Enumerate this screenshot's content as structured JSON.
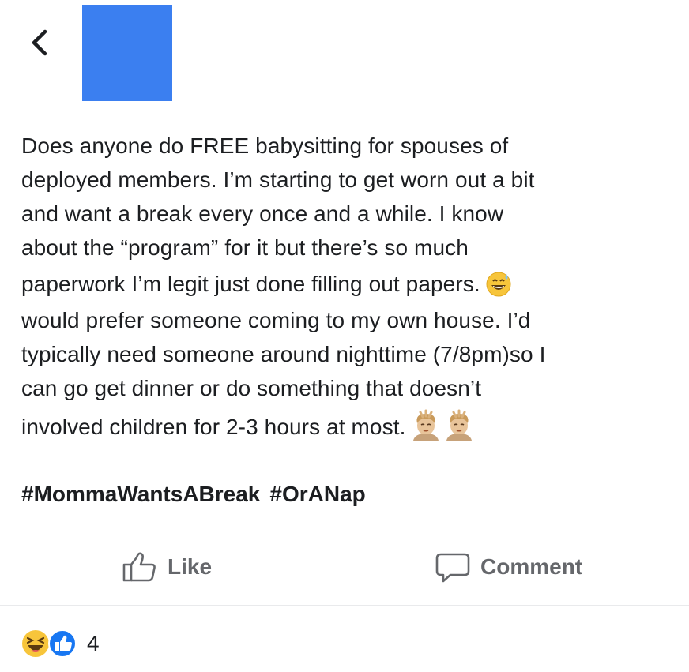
{
  "header": {
    "back_icon": "chevron-left-icon"
  },
  "post": {
    "lines": [
      "Does anyone do FREE babysitting for spouses of",
      "deployed members. I’m starting to get worn out a bit",
      "and want a break every once and a while. I know",
      "about the “program” for it but there’s so much",
      "paperwork I’m legit just done filling out papers.",
      "would prefer someone coming to my own house. I’d",
      "typically need someone around nighttime (7/8pm)so I",
      "can go get dinner or do something that doesn’t",
      "involved children for 2-3 hours at most."
    ],
    "hashtags": [
      "#MommaWantsABreak",
      "#OrANap"
    ]
  },
  "actions": {
    "like_label": "Like",
    "comment_label": "Comment"
  },
  "reactions": {
    "count": "4",
    "icons": [
      "laughing-reaction-icon",
      "like-reaction-icon"
    ]
  },
  "colors": {
    "avatar": "#3b7ff0",
    "like_blue": "#1877f2",
    "action_grey": "#65676b"
  }
}
